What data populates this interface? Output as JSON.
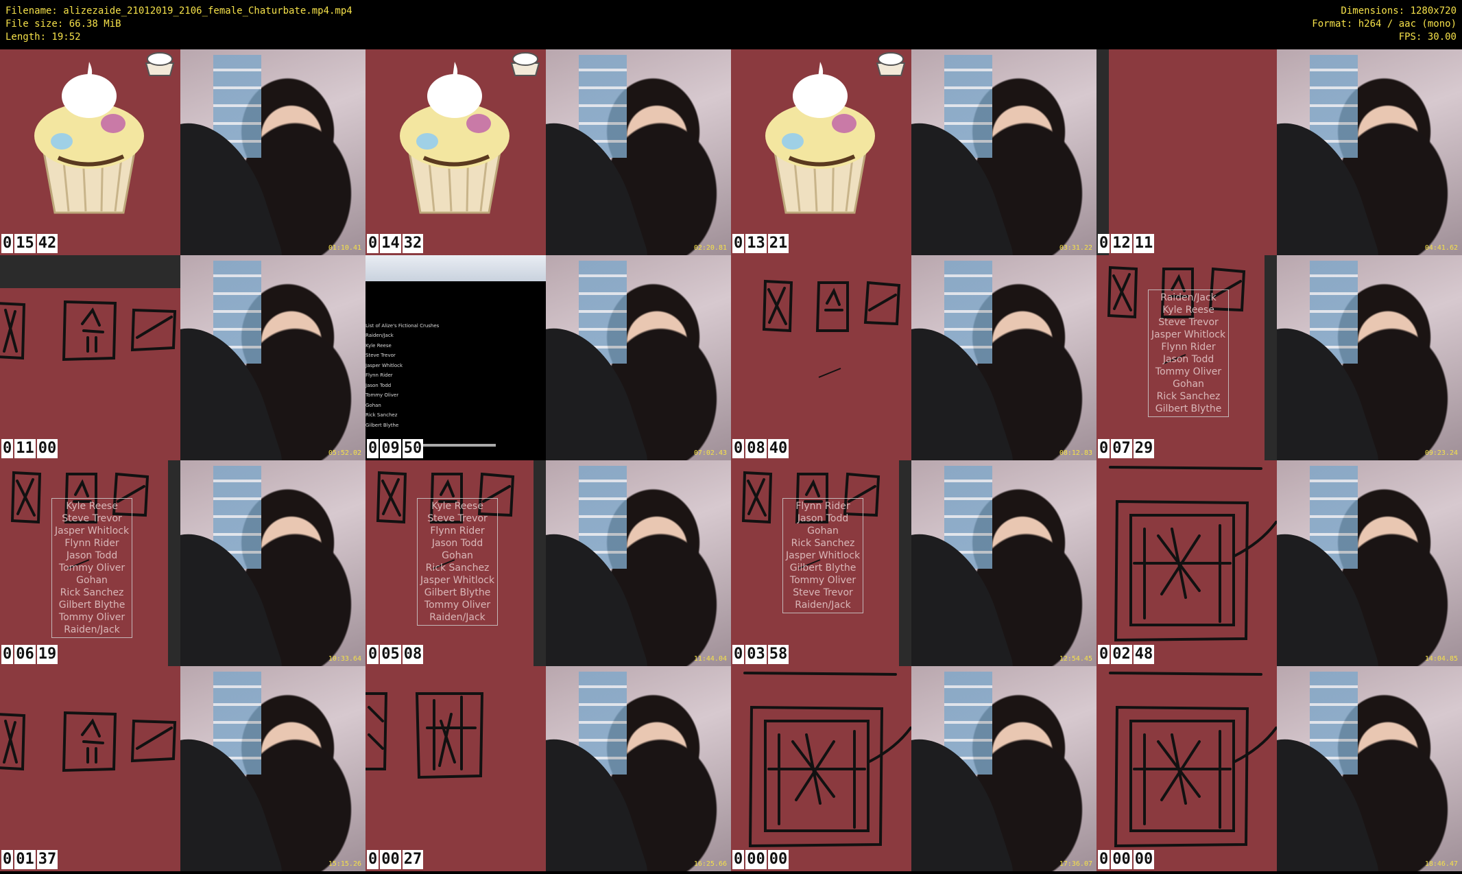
{
  "header": {
    "filename": "Filename: alizezaide_21012019_2106_female_Chaturbate.mp4.mp4",
    "filesize": "File size: 66.38 MiB",
    "length": "Length: 19:52",
    "dimensions": "Dimensions: 1280x720",
    "format": "Format: h264 / aac (mono)",
    "fps": "FPS: 30.00"
  },
  "rows": [
    {
      "pairs": [
        {
          "clock": [
            "0",
            "15",
            "42"
          ],
          "pane": "cupcake",
          "cam_ts": "01:10.41"
        },
        {
          "clock": [
            "0",
            "14",
            "32"
          ],
          "pane": "cupcake",
          "cam_ts": "02:20.81"
        },
        {
          "clock": [
            "0",
            "13",
            "21"
          ],
          "pane": "cupcake",
          "cam_ts": "03:31.22"
        },
        {
          "clock": [
            "0",
            "12",
            "11"
          ],
          "pane": "blank",
          "cam_ts": "04:41.62"
        }
      ]
    },
    {
      "pairs": [
        {
          "clock": [
            "0",
            "11",
            "00"
          ],
          "pane": "sketch-small",
          "cam_ts": "05:52.02"
        },
        {
          "clock": [
            "0",
            "09",
            "50"
          ],
          "pane": "document",
          "cam_ts": "07:02.43"
        },
        {
          "clock": [
            "0",
            "08",
            "40"
          ],
          "pane": "sketch-top",
          "cam_ts": "08:12.83"
        },
        {
          "clock": [
            "0",
            "07",
            "29"
          ],
          "pane": "names-a",
          "cam_ts": "09:23.24"
        }
      ]
    },
    {
      "pairs": [
        {
          "clock": [
            "0",
            "06",
            "19"
          ],
          "pane": "names-b",
          "cam_ts": "10:33.64"
        },
        {
          "clock": [
            "0",
            "05",
            "08"
          ],
          "pane": "names-c",
          "cam_ts": "11:44.04"
        },
        {
          "clock": [
            "0",
            "03",
            "58"
          ],
          "pane": "names-d",
          "cam_ts": "12:54.45"
        },
        {
          "clock": [
            "0",
            "02",
            "48"
          ],
          "pane": "sketch-big",
          "cam_ts": "14:04.85"
        }
      ]
    },
    {
      "pairs": [
        {
          "clock": [
            "0",
            "01",
            "37"
          ],
          "pane": "sketch-small",
          "cam_ts": "15:15.26"
        },
        {
          "clock": [
            "0",
            "00",
            "27"
          ],
          "pane": "sketch-mid",
          "cam_ts": "16:25.66"
        },
        {
          "clock": [
            "0",
            "00",
            "00"
          ],
          "pane": "sketch-big",
          "cam_ts": "17:36.07"
        },
        {
          "clock": [
            "0",
            "00",
            "00"
          ],
          "pane": "sketch-big",
          "cam_ts": "18:46.47"
        }
      ]
    }
  ],
  "names": {
    "a": [
      "Raiden/Jack",
      "Kyle Reese",
      "Steve Trevor",
      "Jasper Whitlock",
      "Flynn Rider",
      "Jason Todd",
      "Tommy Oliver",
      "Gohan",
      "Rick Sanchez",
      "Gilbert Blythe"
    ],
    "b": [
      "Kyle Reese",
      "Steve Trevor",
      "Jasper Whitlock",
      "Flynn Rider",
      "Jason Todd",
      "Tommy Oliver",
      "Gohan",
      "Rick Sanchez",
      "Gilbert Blythe",
      "Tommy Oliver",
      "Raiden/Jack"
    ],
    "c": [
      "Kyle Reese",
      "Steve Trevor",
      "Flynn Rider",
      "Jason Todd",
      "Gohan",
      "Rick Sanchez",
      "Jasper Whitlock",
      "Gilbert Blythe",
      "Tommy Oliver",
      "Raiden/Jack"
    ],
    "d": [
      "Flynn Rider",
      "Jason Todd",
      "Gohan",
      "Rick Sanchez",
      "Jasper Whitlock",
      "Gilbert Blythe",
      "Tommy Oliver",
      "Steve Trevor",
      "Raiden/Jack"
    ]
  },
  "document": {
    "title": "List of Alize's Fictional Crushes",
    "items": [
      "Raiden/Jack",
      "Kyle Reese",
      "Steve Trevor",
      "Jasper Whitlock",
      "Flynn Rider",
      "Jason Todd",
      "Tommy Oliver",
      "Gohan",
      "Rick Sanchez",
      "Gilbert Blythe"
    ]
  }
}
